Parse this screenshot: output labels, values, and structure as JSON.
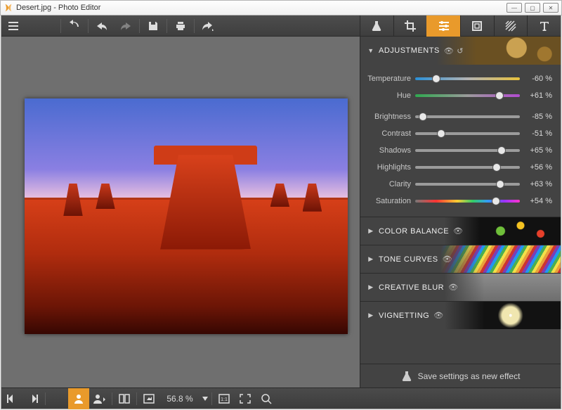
{
  "window": {
    "title": "Desert.jpg - Photo Editor"
  },
  "toolbar": {
    "tabs": [
      "effects",
      "crop",
      "adjust",
      "preset",
      "texture",
      "text"
    ],
    "active_tab": 2
  },
  "panel": {
    "sections": {
      "adjustments": {
        "label": "ADJUSTMENTS",
        "expanded": true
      },
      "color_balance": {
        "label": "COLOR BALANCE",
        "expanded": false
      },
      "tone_curves": {
        "label": "TONE CURVES",
        "expanded": false
      },
      "creative_blur": {
        "label": "CREATIVE BLUR",
        "expanded": false
      },
      "vignetting": {
        "label": "VIGNETTING",
        "expanded": false
      }
    },
    "sliders": {
      "temperature": {
        "label": "Temperature",
        "value": -60,
        "display": "-60 %"
      },
      "hue": {
        "label": "Hue",
        "value": 61,
        "display": "+61 %"
      },
      "brightness": {
        "label": "Brightness",
        "value": -85,
        "display": "-85 %"
      },
      "contrast": {
        "label": "Contrast",
        "value": -51,
        "display": "-51 %"
      },
      "shadows": {
        "label": "Shadows",
        "value": 65,
        "display": "+65 %"
      },
      "highlights": {
        "label": "Highlights",
        "value": 56,
        "display": "+56 %"
      },
      "clarity": {
        "label": "Clarity",
        "value": 63,
        "display": "+63 %"
      },
      "saturation": {
        "label": "Saturation",
        "value": 54,
        "display": "+54 %"
      }
    },
    "footer": {
      "label": "Save settings as new effect"
    }
  },
  "status": {
    "zoom": "56.8 %"
  },
  "colors": {
    "accent": "#e99a2b"
  }
}
